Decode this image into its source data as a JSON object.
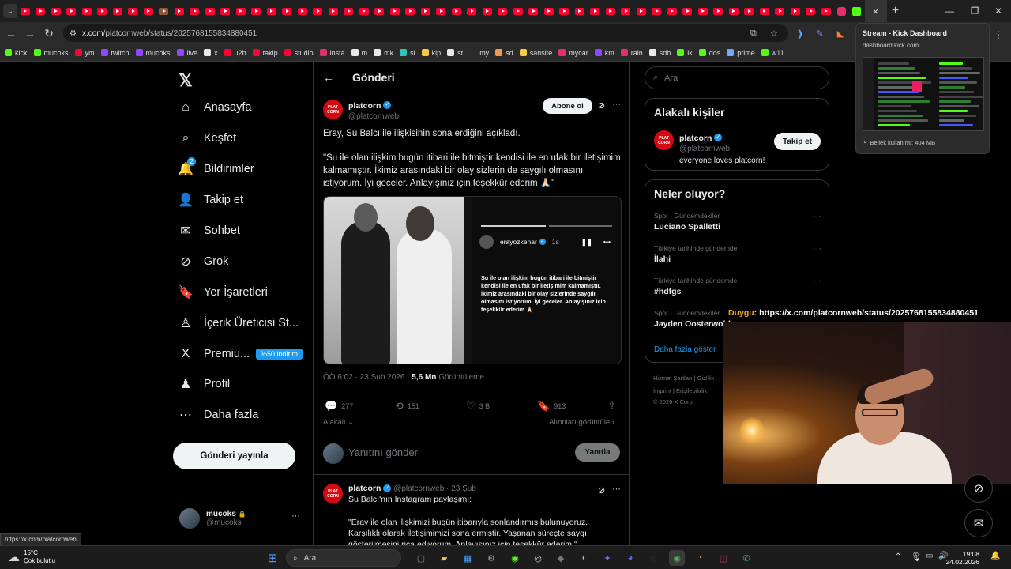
{
  "browser": {
    "active_tab_close": "×",
    "new_tab": "+",
    "url_host": "x.com",
    "url_path": "/platcornweb/status/2025768155834880451",
    "status_url": "https://x.com/platcornweb",
    "bookmarks": [
      {
        "label": "kick",
        "color": "#53fc18"
      },
      {
        "label": "mucoks",
        "color": "#53fc18"
      },
      {
        "label": "ym",
        "color": "#ff0033"
      },
      {
        "label": "twitch",
        "color": "#9146ff"
      },
      {
        "label": "mucoks",
        "color": "#9146ff"
      },
      {
        "label": "live",
        "color": "#9146ff"
      },
      {
        "label": "x",
        "color": "#e7e9ea"
      },
      {
        "label": "u2b",
        "color": "#ff0033"
      },
      {
        "label": "takip",
        "color": "#ff0033"
      },
      {
        "label": "studio",
        "color": "#ff0033"
      },
      {
        "label": "insta",
        "color": "#e1306c"
      },
      {
        "label": "m",
        "color": "#e7e9ea"
      },
      {
        "label": "mk",
        "color": "#e7e9ea"
      },
      {
        "label": "sl",
        "color": "#2ec4b6"
      },
      {
        "label": "kip",
        "color": "#f7c948"
      },
      {
        "label": "st",
        "color": "#e7e9ea"
      },
      {
        "label": "my",
        "color": "#2a2a2a"
      },
      {
        "label": "sd",
        "color": "#f2994a"
      },
      {
        "label": "sansite",
        "color": "#f7c948"
      },
      {
        "label": "mycar",
        "color": "#e1306c"
      },
      {
        "label": "km",
        "color": "#9146ff"
      },
      {
        "label": "rain",
        "color": "#e1306c"
      },
      {
        "label": "sdb",
        "color": "#e7e9ea"
      },
      {
        "label": "ik",
        "color": "#53fc18"
      },
      {
        "label": "dos",
        "color": "#53fc18"
      },
      {
        "label": "prime",
        "color": "#6fa8ff"
      },
      {
        "label": "w11",
        "color": "#53fc18"
      }
    ]
  },
  "tab_popup": {
    "title": "Stream - Kick Dashboard",
    "domain": "dashboard.kick.com",
    "memory": "Bellek kullanımı: 404 MB"
  },
  "nav": {
    "items": [
      {
        "label": "Anasayfa",
        "icon": "home-icon",
        "glyph": "⌂"
      },
      {
        "label": "Keşfet",
        "icon": "search-icon",
        "glyph": "⌕"
      },
      {
        "label": "Bildirimler",
        "icon": "bell-icon",
        "glyph": "🔔",
        "badge": "2"
      },
      {
        "label": "Takip et",
        "icon": "add-person-icon",
        "glyph": "👤"
      },
      {
        "label": "Sohbet",
        "icon": "mail-icon",
        "glyph": "✉"
      },
      {
        "label": "Grok",
        "icon": "grok-icon",
        "glyph": "⊘"
      },
      {
        "label": "Yer İşaretleri",
        "icon": "bookmark-icon",
        "glyph": "🔖"
      },
      {
        "label": "İçerik Üreticisi St...",
        "icon": "creator-studio-icon",
        "glyph": "♙"
      },
      {
        "label": "Premiu...",
        "icon": "x-premium-icon",
        "glyph": "X",
        "promo": "%50 indirim"
      },
      {
        "label": "Profil",
        "icon": "profile-icon",
        "glyph": "♟"
      },
      {
        "label": "Daha fazla",
        "icon": "more-circle-icon",
        "glyph": "⋯"
      }
    ],
    "post_button": "Gönderi yayınla",
    "account_name": "mucoks",
    "account_handle": "@mucoks",
    "account_more": "···"
  },
  "main": {
    "header": "Gönderi",
    "author_name": "platcorn",
    "author_handle": "@platcornweb",
    "avatar_text": "PLAT CORN",
    "subscribe": "Abone ol",
    "text1": "Eray, Su Balcı ile ilişkisinin sona erdiğini açıkladı.",
    "text2": "\"Su ile olan ilişkim bugün itibari ile bitmiştir kendisi ile en ufak bir iletişimim kalmamıştır. İkimiz arasındaki bir olay sizlerin de saygılı olmasını istiyorum. İyi geceler. Anlayışınız için teşekkür ederim 🙏🏻\"",
    "story_user": "erayozkenar",
    "story_time": "1s",
    "story_text": "Su ile olan ilişkim bugün itibari ile bitmiştir kendisi ile en ufak bir iletişimim kalmamıştır. İkimiz arasındaki bir olay sizlerinde saygılı olmasını istiyorum. İyi geceler. Anlayışınız için teşekkür ederim 🙏🏻",
    "meta_time": "ÖÖ 6:02 · 23 Şub 2026 · ",
    "meta_views": "5,6 Mn",
    "meta_views_label": " Görüntüleme",
    "replies": "277",
    "reposts": "151",
    "likes": "3 B",
    "bookmarks": "913",
    "relevant": "Alakalı",
    "quotes": "Alıntıları görüntüle",
    "reply_placeholder": "Yanıtını gönder",
    "reply_button": "Yanıtla",
    "reply_author": "platcorn",
    "reply_meta": "@platcornweb · 23 Şub",
    "reply_text1": "Su Balcı'nın Instagram paylaşımı:",
    "reply_text2": "\"Eray ile olan ilişkimizi bugün itibarıyla sonlandırmış bulunuyoruz. Karşılıklı olarak iletişimimizi sona ermiştir. Yaşanan süreçte saygı gösterilmesini rica ediyorum. Anlayışınız için teşekkür ederim.\""
  },
  "right": {
    "search_placeholder": "Ara",
    "relevant_title": "Alakalı kişiler",
    "person_name": "platcorn",
    "person_handle": "@platcornweb",
    "person_bio": "everyone loves platcorn!",
    "follow": "Takip et",
    "trends_title": "Neler oluyor?",
    "trends": [
      {
        "category": "Spor · Gündemdekiler",
        "name": "Luciano Spalletti"
      },
      {
        "category": "Türkiye tarihinde gündemde",
        "name": "İlahi"
      },
      {
        "category": "Türkiye tarihinde gündemde",
        "name": "#hdfgs"
      },
      {
        "category": "Spor · Gündemdekiler",
        "name": "Jayden Oosterwolde"
      }
    ],
    "show_more": "Daha fazla göster",
    "footer1": "Hizmet Şartları  |  Gizlilik",
    "footer2": "İmprint  |  Erişilebilirlik",
    "footer3": "© 2026 X Corp."
  },
  "overlay": {
    "chat_user": "Duygu",
    "chat_text": ": https://x.com/platcornweb/status/2025768155834880451"
  },
  "taskbar": {
    "temp": "15°C",
    "weather": "Çok bulutlu",
    "search": "Ara",
    "time": "19:08",
    "date": "24.02.2026"
  },
  "colors": {
    "accent": "#1d9bf0",
    "youtube": "#ff0033",
    "kick": "#53fc18"
  }
}
